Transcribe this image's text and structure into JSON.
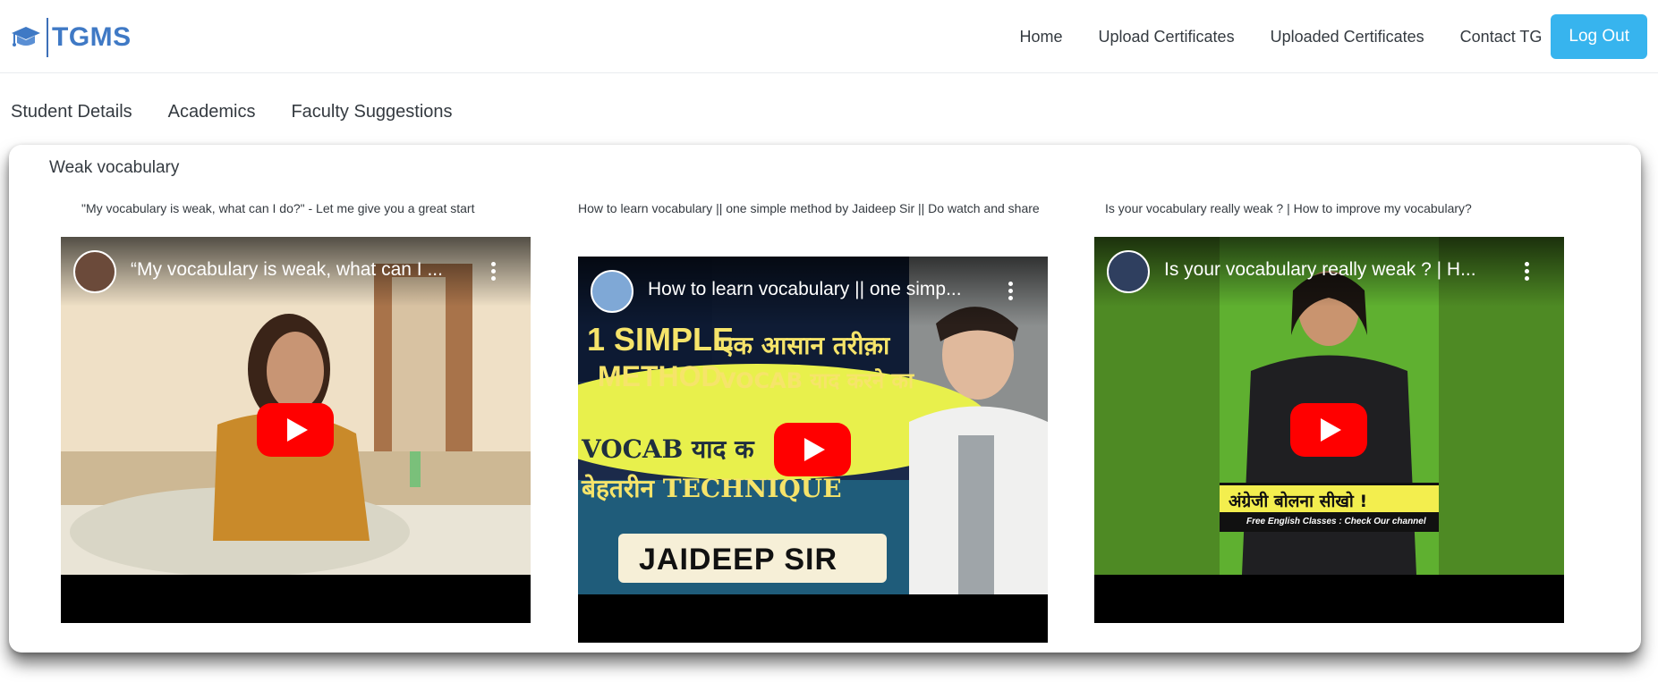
{
  "brand": {
    "name": "TGMS"
  },
  "nav": {
    "home": "Home",
    "upload_certificates": "Upload Certificates",
    "uploaded_certificates": "Uploaded Certificates",
    "contact_tg": "Contact TG",
    "logout": "Log Out"
  },
  "subtabs": {
    "student_details": "Student Details",
    "academics": "Academics",
    "faculty_suggestions": "Faculty Suggestions"
  },
  "section": {
    "title": "Weak vocabulary",
    "videos": [
      {
        "caption": "\"My vocabulary is weak, what can I do?\" - Let me give you a great start",
        "player_title": "“My vocabulary is weak, what can I ...",
        "play_icon": "youtube-play-icon",
        "menu_icon": "kebab-menu-icon"
      },
      {
        "caption": "How to learn vocabulary || one simple method by Jaideep Sir || Do watch and share",
        "player_title": "How to learn vocabulary || one simp...",
        "thumb_text": {
          "line1": "1 SIMPLE",
          "line2": "METHOD",
          "hindi1": "एक आसान तरीक़ा",
          "hindi2": "VOCAB याद करने का",
          "band1": "VOCAB याद क",
          "band2": "बेहतरीन TECHNIQUE",
          "badge": "JAIDEEP SIR"
        },
        "play_icon": "youtube-play-icon",
        "menu_icon": "kebab-menu-icon"
      },
      {
        "caption": "Is your vocabulary really weak ? | How to improve my vocabulary?",
        "player_title": "Is your vocabulary really weak ? | H...",
        "thumb_text": {
          "banner": "अंग्रेजी बोलना सीखो !",
          "sub": "Free English Classes : Check Our channel"
        },
        "play_icon": "youtube-play-icon",
        "menu_icon": "kebab-menu-icon"
      }
    ]
  },
  "colors": {
    "brand_blue": "#3f79c5",
    "logout_bg": "#37b4ee",
    "youtube_red": "#ff0000"
  }
}
